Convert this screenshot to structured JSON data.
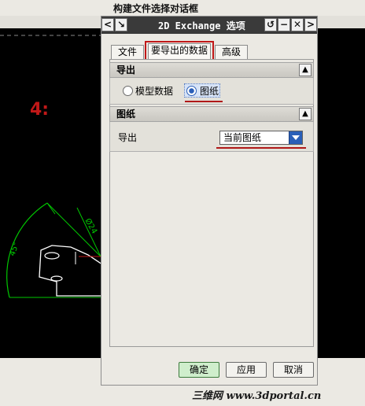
{
  "background": {
    "window_title": "构建文件选择对话框",
    "step_label": "4:",
    "dim_angle": "45°",
    "dim_diameter": "Ø24"
  },
  "dialog": {
    "title": "2D Exchange 选项",
    "controls": [
      "reset-icon",
      "minimize-icon",
      "close-icon"
    ],
    "tabs": [
      {
        "label": "文件",
        "active": false
      },
      {
        "label": "要导出的数据",
        "active": true
      },
      {
        "label": "高级",
        "active": false
      }
    ],
    "export_group": {
      "title": "导出",
      "options": [
        {
          "label": "模型数据",
          "selected": false
        },
        {
          "label": "图纸",
          "selected": true
        }
      ]
    },
    "drawing_group": {
      "title": "图纸",
      "field_label": "导出",
      "selected_value": "当前图纸"
    },
    "buttons": {
      "ok": "确定",
      "apply": "应用",
      "cancel": "取消"
    }
  },
  "watermark": "三维网 www.3dportal.cn",
  "colors": {
    "annotation_red": "#c01818",
    "cad_green": "#00c800",
    "select_blue": "#2a5fb8"
  }
}
